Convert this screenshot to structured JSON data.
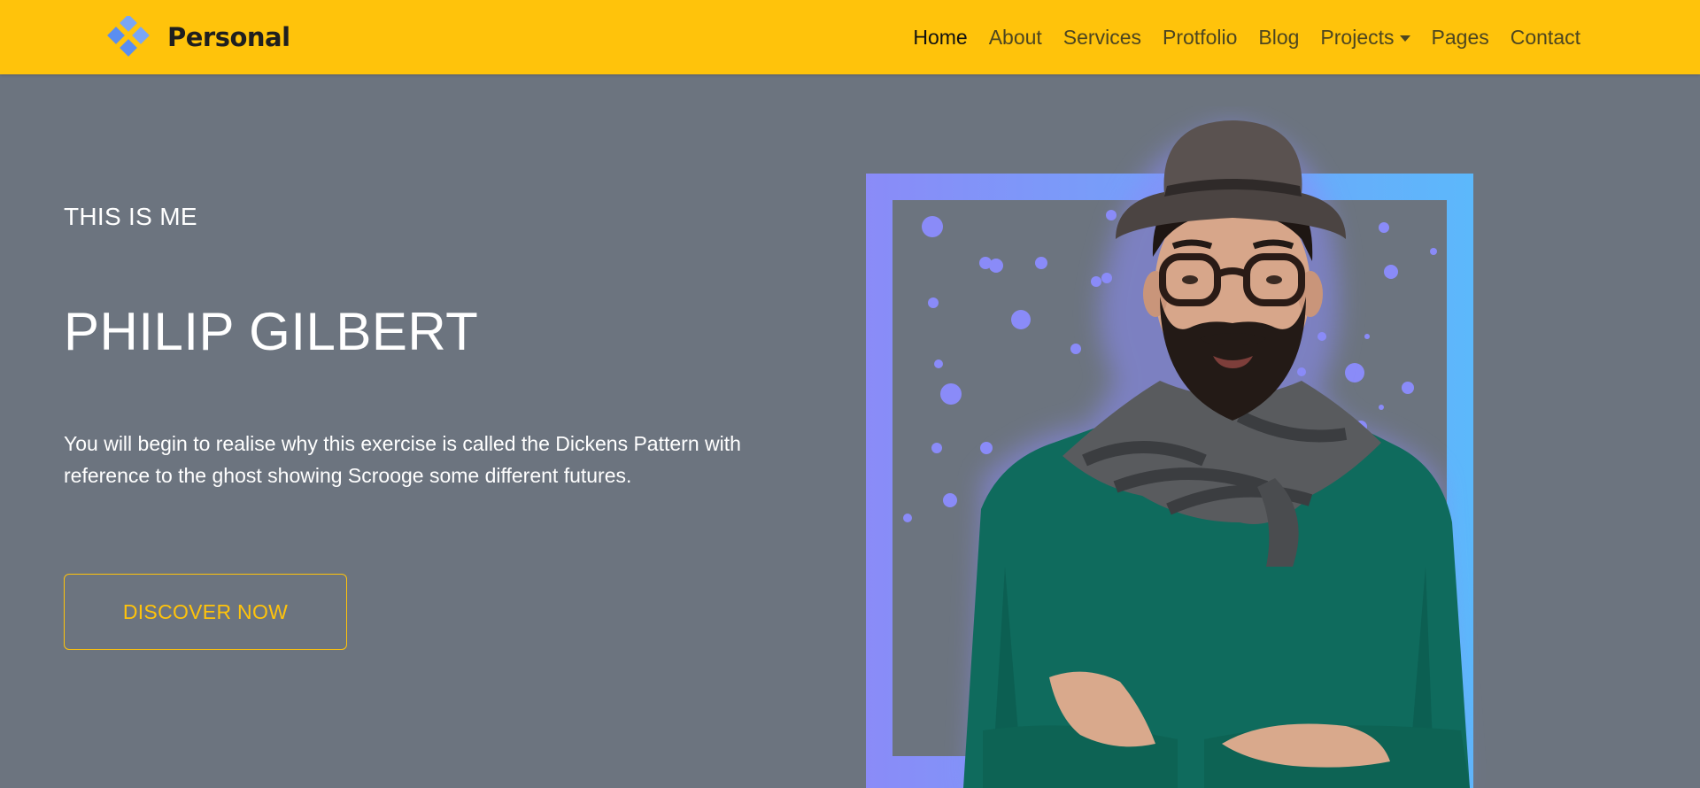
{
  "brand": {
    "name": "Personal",
    "logo_icon": "diamond-logo-icon"
  },
  "nav": {
    "items": [
      {
        "label": "Home",
        "active": true
      },
      {
        "label": "About"
      },
      {
        "label": "Services"
      },
      {
        "label": "Protfolio"
      },
      {
        "label": "Blog"
      },
      {
        "label": "Projects",
        "has_dropdown": true
      },
      {
        "label": "Pages"
      },
      {
        "label": "Contact"
      }
    ]
  },
  "hero": {
    "eyebrow": "THIS IS ME",
    "title": "PHILIP GILBERT",
    "description": "You will begin to realise why this exercise is called the Dickens Pattern with reference to the ghost showing Scrooge some different futures.",
    "cta_label": "DISCOVER NOW"
  },
  "colors": {
    "navbar": "#ffc30b",
    "background": "#6c747f",
    "accent": "#ffc30b",
    "frame_gradient_start": "#8a8bf8",
    "frame_gradient_end": "#5cb8fb"
  }
}
